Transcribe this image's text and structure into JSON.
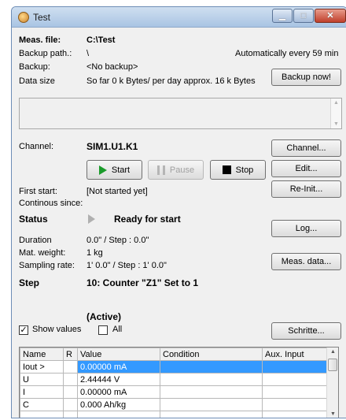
{
  "window": {
    "title": "Test"
  },
  "meas": {
    "file_label": "Meas. file:",
    "file_value": "C:\\Test",
    "backup_path_label": "Backup path.:",
    "backup_path_value": "\\",
    "auto_backup": "Automatically every 59 min",
    "backup_label": "Backup:",
    "backup_value": "<No backup>",
    "backup_now": "Backup now!",
    "data_size_label": "Data size",
    "data_size_value": "So far 0 k Bytes/ per day approx. 16 k Bytes"
  },
  "channel": {
    "label": "Channel:",
    "value": "SIM1.U1.K1",
    "channel_button": "Channel...",
    "start": "Start",
    "pause": "Pause",
    "stop": "Stop",
    "edit": "Edit...",
    "first_start_label": "First start:",
    "first_start_value": "[Not started yet]",
    "continuous_since_label": "Continous since:",
    "reinit": "Re-Init..."
  },
  "status": {
    "label": "Status",
    "value": "Ready for start",
    "log": "Log...",
    "duration_label": "Duration",
    "duration_value": "0.0\" / Step : 0.0\"",
    "mat_weight_label": "Mat. weight:",
    "mat_weight_value": "1 kg",
    "sampling_label": "Sampling rate:",
    "sampling_value": "1' 0.0\" / Step : 1' 0.0\"",
    "meas_data": "Meas. data..."
  },
  "step": {
    "label": "Step",
    "value": "10: Counter \"Z1\" Set to 1",
    "active": "(Active)",
    "show_values": "Show values",
    "show_values_checked": "✓",
    "all": "All",
    "schritte": "Schritte..."
  },
  "grid": {
    "headers": [
      "Name",
      "R",
      "Value",
      "Condition",
      "Aux. Input"
    ],
    "rows": [
      [
        "Iout >",
        "",
        "0.00000 mA",
        "",
        ""
      ],
      [
        "U",
        "",
        "2.44444 V",
        "",
        ""
      ],
      [
        "I",
        "",
        "0.00000 mA",
        "",
        ""
      ],
      [
        "C",
        "",
        "0.000 Ah/kg",
        "",
        ""
      ]
    ]
  },
  "colors": {
    "selection": "#3399ff",
    "start_green": "#1a9b2a"
  }
}
